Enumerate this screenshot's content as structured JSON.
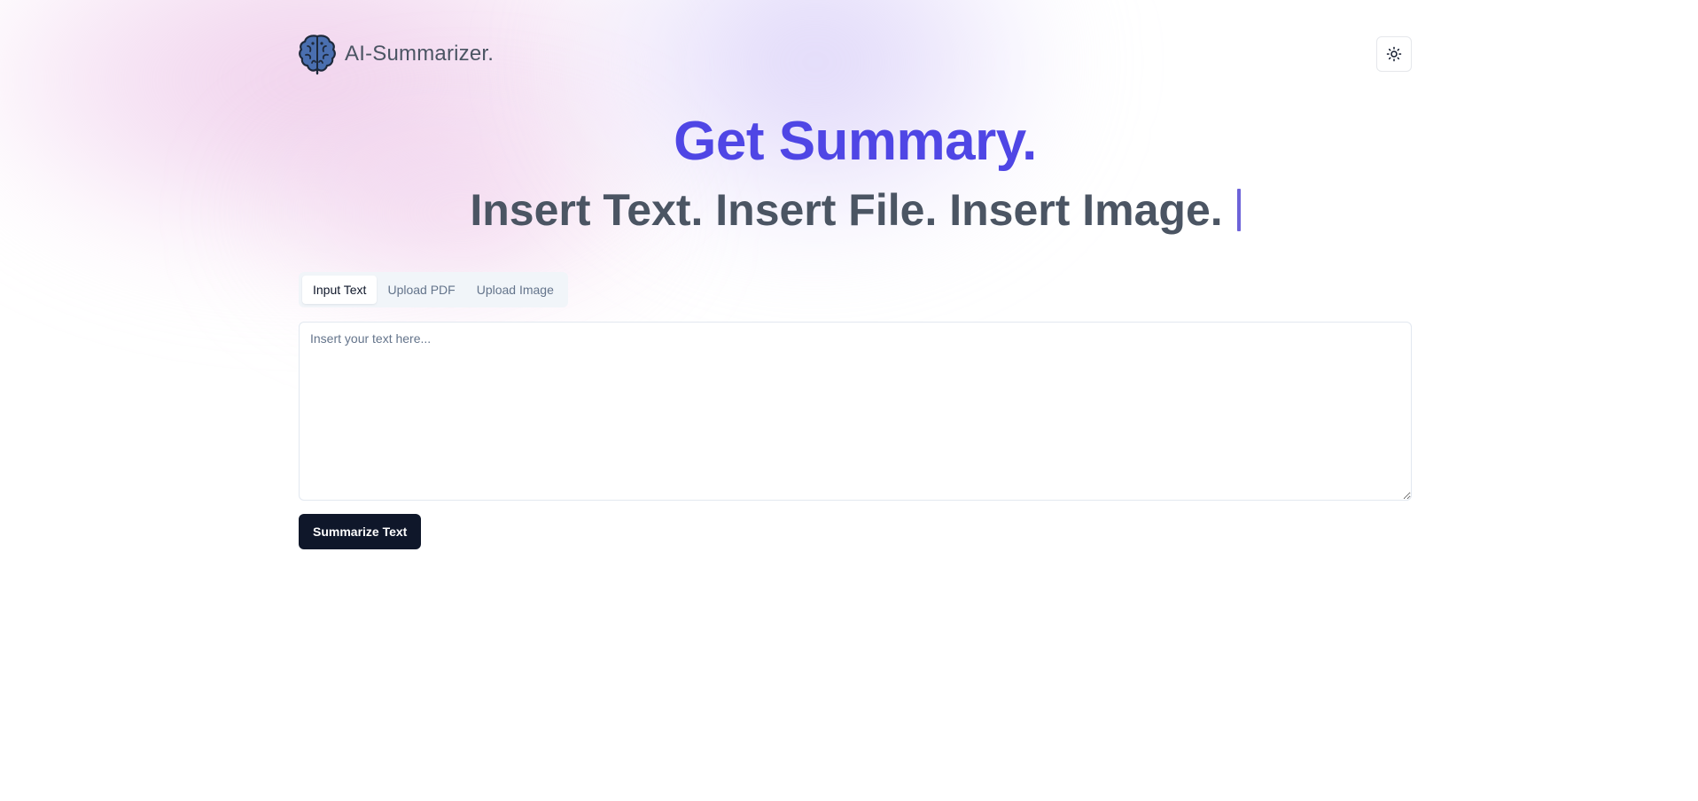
{
  "brand": {
    "name": "AI-Summarizer.",
    "logo_icon": "brain-icon"
  },
  "header": {
    "theme_toggle_icon": "sun-icon"
  },
  "hero": {
    "title": "Get Summary.",
    "subtitle": "Insert Text. Insert File. Insert Image."
  },
  "tabs": [
    {
      "label": "Input Text",
      "active": true
    },
    {
      "label": "Upload PDF",
      "active": false
    },
    {
      "label": "Upload Image",
      "active": false
    }
  ],
  "text_input": {
    "placeholder": "Insert your text here...",
    "value": ""
  },
  "actions": {
    "summarize_label": "Summarize Text"
  },
  "colors": {
    "accent": "#4f46e5",
    "heading_gray": "#4b5563",
    "button_bg": "#0f172a",
    "caret": "#6d63d9"
  }
}
